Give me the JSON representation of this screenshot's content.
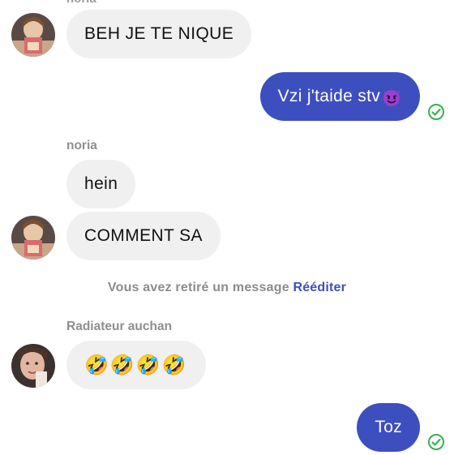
{
  "conversation": {
    "top_partial_sender": "noria",
    "messages": [
      {
        "text": "BEH JE TE NIQUE"
      },
      {
        "text": "Vzi j'taide stv"
      },
      {
        "text": "hein"
      },
      {
        "text": "COMMENT SA"
      },
      {
        "text": "🤣🤣🤣🤣"
      },
      {
        "text": "Toz"
      }
    ],
    "senders": {
      "noria": "noria",
      "radiateur": "Radiateur auchan"
    },
    "system_notice": {
      "text": "Vous avez retiré un message",
      "action": "Rééditer"
    }
  },
  "colors": {
    "outgoing_bubble": "#3d4fbf",
    "incoming_bubble": "#f0f0f0",
    "read_check": "#34b34a",
    "sender_label": "#8f8f8f"
  },
  "icons": {
    "read_receipt": "check-circle-icon",
    "emoji_devil": "smiling-devil-emoji"
  }
}
